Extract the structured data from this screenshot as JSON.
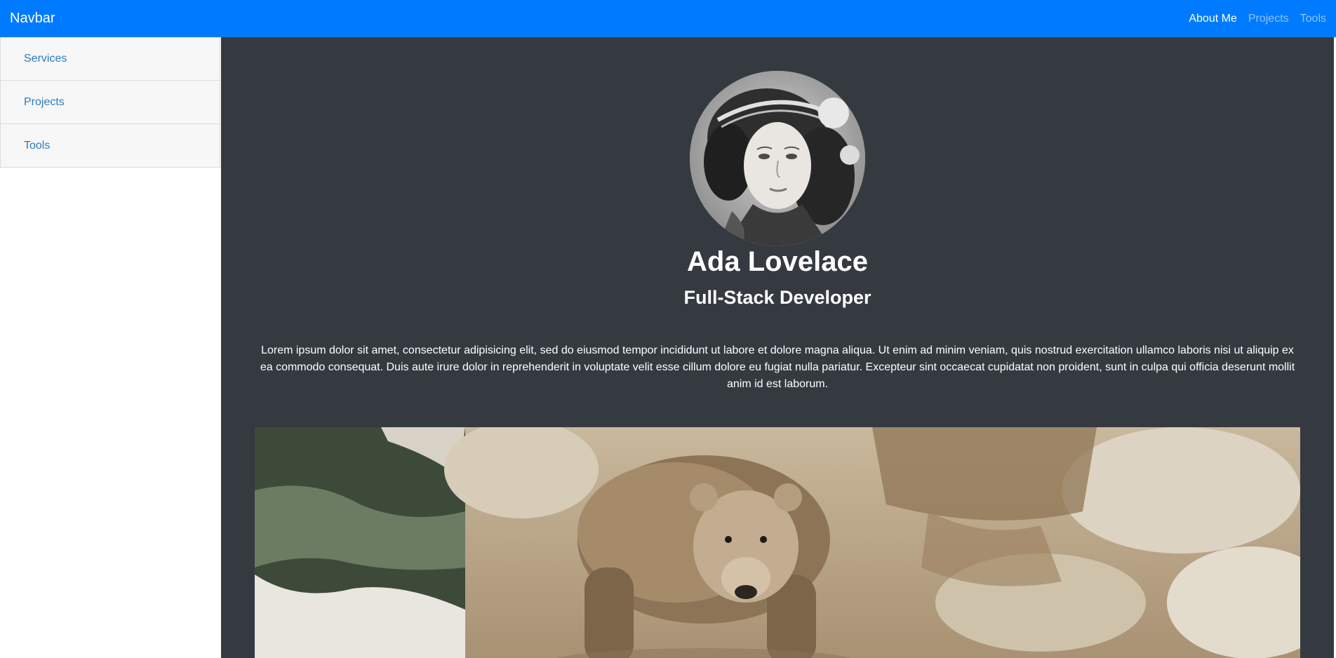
{
  "navbar": {
    "brand": "Navbar",
    "links": [
      {
        "label": "About Me",
        "active": true
      },
      {
        "label": "Projects",
        "active": false
      },
      {
        "label": "Tools",
        "active": false
      }
    ]
  },
  "sidebar": {
    "items": [
      {
        "label": "Services"
      },
      {
        "label": "Projects"
      },
      {
        "label": "Tools"
      }
    ]
  },
  "profile": {
    "name": "Ada Lovelace",
    "role": "Full-Stack Developer",
    "bio": "Lorem ipsum dolor sit amet, consectetur adipisicing elit, sed do eiusmod tempor incididunt ut labore et dolore magna aliqua. Ut enim ad minim veniam, quis nostrud exercitation ullamco laboris nisi ut aliquip ex ea commodo consequat. Duis aute irure dolor in reprehenderit in voluptate velit esse cillum dolore eu fugiat nulla pariatur. Excepteur sint occaecat cupidatat non proident, sunt in culpa qui officia deserunt mollit anim id est laborum."
  },
  "colors": {
    "navbar_bg": "#007bff",
    "main_bg": "#343a40",
    "sidebar_bg": "#f7f7f7",
    "sidebar_link": "#2b7bbf"
  },
  "images": {
    "avatar": "portrait-engraving",
    "photo": "bear-on-rocks"
  }
}
